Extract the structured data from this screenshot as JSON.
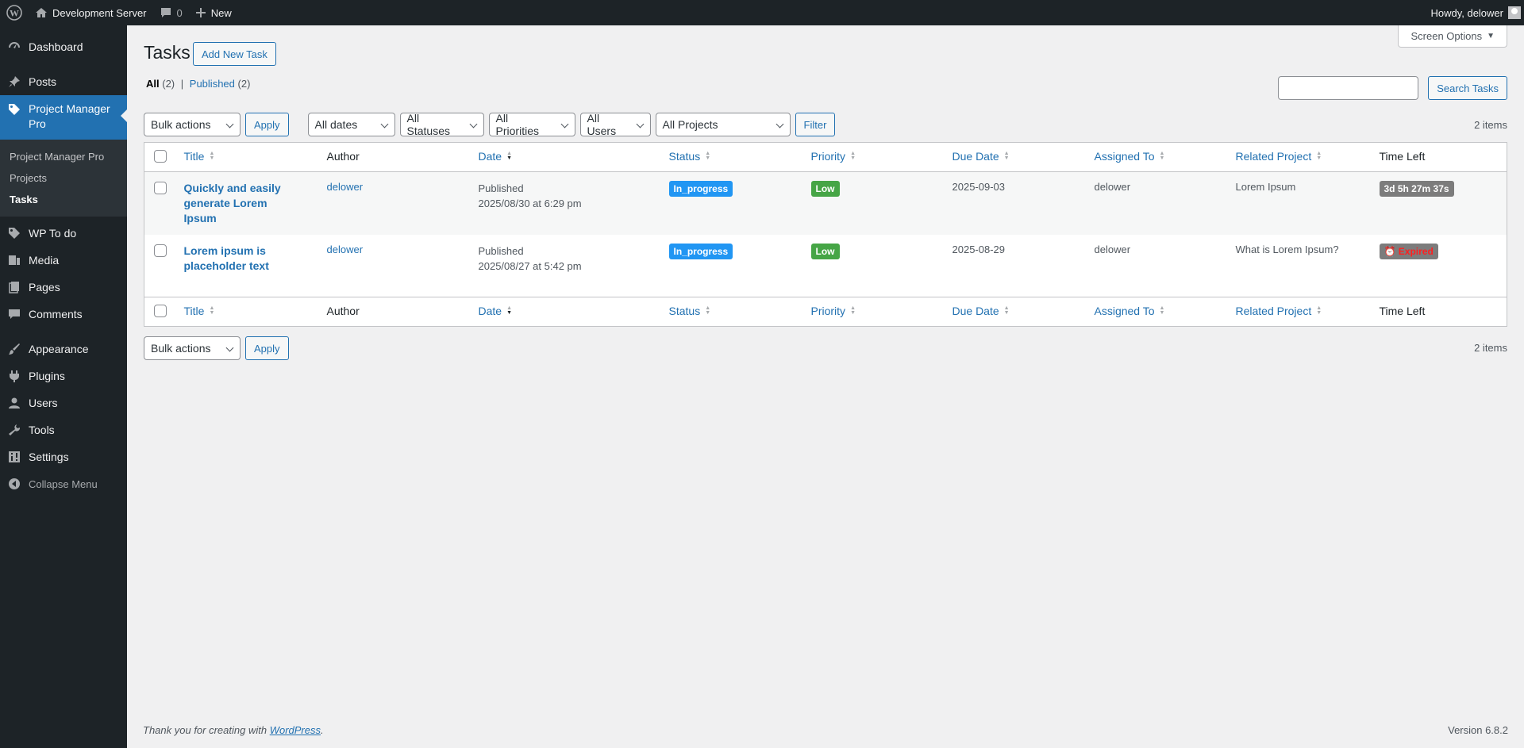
{
  "adminbar": {
    "site_name": "Development Server",
    "comments_count": "0",
    "new_label": "New",
    "howdy": "Howdy, delower"
  },
  "sidebar": {
    "items": [
      {
        "label": "Dashboard",
        "icon": "dashboard-icon"
      },
      {
        "label": "Posts",
        "icon": "pin-icon"
      },
      {
        "label": "Project Manager Pro",
        "icon": "tag-icon"
      },
      {
        "label": "WP To do",
        "icon": "tag-icon"
      },
      {
        "label": "Media",
        "icon": "media-icon"
      },
      {
        "label": "Pages",
        "icon": "pages-icon"
      },
      {
        "label": "Comments",
        "icon": "comment-icon"
      },
      {
        "label": "Appearance",
        "icon": "brush-icon"
      },
      {
        "label": "Plugins",
        "icon": "plugin-icon"
      },
      {
        "label": "Users",
        "icon": "users-icon"
      },
      {
        "label": "Tools",
        "icon": "wrench-icon"
      },
      {
        "label": "Settings",
        "icon": "settings-icon"
      },
      {
        "label": "Collapse Menu",
        "icon": "collapse-icon"
      }
    ],
    "submenu": [
      "Project Manager Pro",
      "Projects",
      "Tasks"
    ]
  },
  "header": {
    "screen_options": "Screen Options",
    "title": "Tasks",
    "add_new": "Add New Task"
  },
  "views": {
    "all_label": "All",
    "all_count": "(2)",
    "separator": "|",
    "published_label": "Published",
    "published_count": "(2)"
  },
  "search": {
    "button": "Search Tasks"
  },
  "filters": {
    "bulk_actions": "Bulk actions",
    "apply": "Apply",
    "dates": "All dates",
    "statuses": "All Statuses",
    "priorities": "All Priorities",
    "users": "All Users",
    "projects": "All Projects",
    "filter": "Filter",
    "items_count": "2 items"
  },
  "table": {
    "columns": [
      "Title",
      "Author",
      "Date",
      "Status",
      "Priority",
      "Due Date",
      "Assigned To",
      "Related Project",
      "Time Left"
    ],
    "rows": [
      {
        "title": "Quickly and easily generate Lorem Ipsum",
        "author": "delower",
        "date_status": "Published",
        "date": "2025/08/30 at 6:29 pm",
        "status": "In_progress",
        "priority": "Low",
        "due_date": "2025-09-03",
        "assigned_to": "delower",
        "related_project": "Lorem Ipsum",
        "time_left": "3d 5h 27m 37s"
      },
      {
        "title": "Lorem ipsum is placeholder text",
        "author": "delower",
        "date_status": "Published",
        "date": "2025/08/27 at 5:42 pm",
        "status": "In_progress",
        "priority": "Low",
        "due_date": "2025-08-29",
        "assigned_to": "delower",
        "related_project": "What is Lorem Ipsum?",
        "time_left": "Expired",
        "time_left_icon": "alarm-clock-icon"
      }
    ]
  },
  "footer": {
    "thanks_prefix": "Thank you for creating with",
    "wordpress_link": "WordPress",
    "thanks_suffix": ".",
    "version": "Version 6.8.2"
  },
  "colors": {
    "adminbar_bg": "#1d2327",
    "accent": "#2271b1",
    "status_in_progress": "#2196f3",
    "priority_low": "#46a546",
    "time_left_bg": "#7c7c7c",
    "expired_text": "#ff1f1f"
  }
}
